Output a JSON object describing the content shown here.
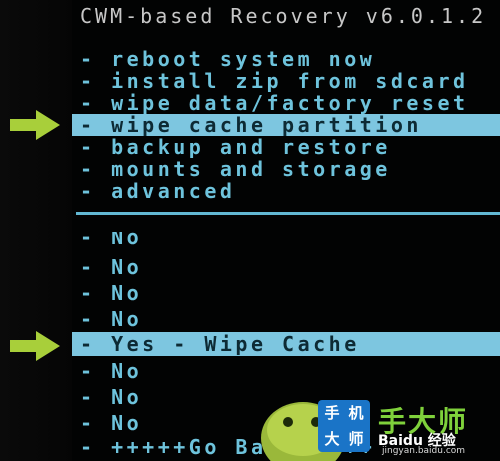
{
  "header": {
    "title": "CWM-based Recovery v6.0.1.2"
  },
  "main_menu": {
    "items": [
      "- reboot system now",
      "- install zip from sdcard",
      "- wipe data/factory reset",
      "- wipe cache partition",
      "- backup and restore",
      "- mounts and storage",
      "- advanced"
    ],
    "selected_index": 3
  },
  "confirm_menu": {
    "items": [
      "- No",
      "- No",
      "- No",
      "- No",
      "- Yes - Wipe Cache",
      "- No",
      "- No",
      "- No",
      "- +++++Go Back+++++"
    ],
    "selected_index": 4
  },
  "watermark": {
    "box_chars": [
      "手",
      "机",
      "大",
      "师"
    ],
    "big_text": "手大师",
    "baidu": "Baidu 经验",
    "url": "jingyan.baidu.com"
  },
  "colors": {
    "menu_text": "#6ec3dc",
    "highlight": "#7dc6e0",
    "arrow": "#a8cf3a",
    "title_text": "#c7c7c7"
  },
  "icons": {
    "pointer_arrow": "arrow-right-icon",
    "mascot": "android-mascot-icon"
  }
}
